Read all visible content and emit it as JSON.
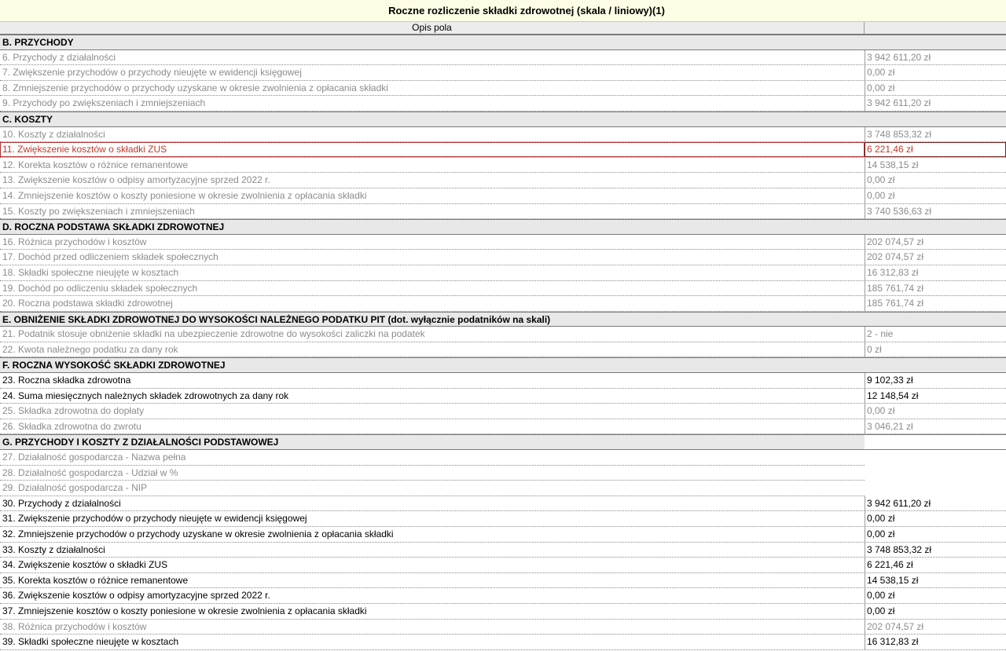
{
  "title": "Roczne rozliczenie składki zdrowotnej (skala / liniowy)(1)",
  "header": {
    "description_col": "Opis pola",
    "value_col": ""
  },
  "rows": [
    {
      "type": "section",
      "text": "B. PRZYCHODY",
      "full": true
    },
    {
      "type": "row",
      "text": "6. Przychody z działalności",
      "value": "3 942 611,20 zł",
      "gray": true
    },
    {
      "type": "row",
      "text": "7. Zwiększenie przychodów o przychody nieujęte w ewidencji księgowej",
      "value": "0,00 zł",
      "gray": true
    },
    {
      "type": "row",
      "text": "8. Zmniejszenie przychodów o przychody uzyskane w okresie zwolnienia z opłacania składki",
      "value": "0,00 zł",
      "gray": true
    },
    {
      "type": "row",
      "text": "9. Przychody po zwiększeniach i zmniejszeniach",
      "value": "3 942 611,20 zł",
      "gray": true
    },
    {
      "type": "section",
      "text": "C. KOSZTY",
      "full": true
    },
    {
      "type": "row",
      "text": "10. Koszty z działalności",
      "value": "3 748 853,32 zł",
      "gray": true
    },
    {
      "type": "row",
      "text": "11. Zwiększenie kosztów o składki ZUS",
      "value": "6 221,46 zł",
      "selected": true
    },
    {
      "type": "row",
      "text": "12. Korekta kosztów o różnice remanentowe",
      "value": "14 538,15 zł",
      "gray": true
    },
    {
      "type": "row",
      "text": "13. Zwiększenie kosztów o odpisy amortyzacyjne sprzed 2022 r.",
      "value": "0,00 zł",
      "gray": true
    },
    {
      "type": "row",
      "text": "14. Zmniejszenie kosztów o koszty poniesione w okresie zwolnienia z opłacania składki",
      "value": "0,00 zł",
      "gray": true
    },
    {
      "type": "row",
      "text": "15. Koszty po zwiększeniach i zmniejszeniach",
      "value": "3 740 536,63 zł",
      "gray": true
    },
    {
      "type": "section",
      "text": "D. ROCZNA PODSTAWA SKŁADKI ZDROWOTNEJ",
      "full": true
    },
    {
      "type": "row",
      "text": "16. Różnica przychodów i kosztów",
      "value": "202 074,57 zł",
      "gray": true
    },
    {
      "type": "row",
      "text": "17. Dochód przed odliczeniem składek społecznych",
      "value": "202 074,57 zł",
      "gray": true
    },
    {
      "type": "row",
      "text": "18. Składki społeczne nieujęte w kosztach",
      "value": "16 312,83 zł",
      "gray": true
    },
    {
      "type": "row",
      "text": "19. Dochód po odliczeniu składek społecznych",
      "value": "185 761,74 zł",
      "gray": true
    },
    {
      "type": "row",
      "text": "20. Roczna podstawa składki zdrowotnej",
      "value": "185 761,74 zł",
      "gray": true
    },
    {
      "type": "section",
      "text": "E. OBNIŻENIE SKŁADKI ZDROWOTNEJ DO WYSOKOŚCI NALEŻNEGO PODATKU PIT (dot. wyłącznie podatników na skali)",
      "full": true
    },
    {
      "type": "row",
      "text": "21. Podatnik stosuje obniżenie składki na ubezpieczenie zdrowotne do wysokości zaliczki na podatek",
      "value": "2 - nie",
      "gray": true
    },
    {
      "type": "row",
      "text": "22. Kwota należnego podatku za dany rok",
      "value": "0 zł",
      "gray": true
    },
    {
      "type": "section",
      "text": "F. ROCZNA WYSOKOŚĆ SKŁADKI ZDROWOTNEJ",
      "full": true
    },
    {
      "type": "row",
      "text": "23. Roczna składka zdrowotna",
      "value": "9 102,33 zł"
    },
    {
      "type": "row",
      "text": "24. Suma miesięcznych należnych składek zdrowotnych za dany rok",
      "value": "12 148,54 zł"
    },
    {
      "type": "row",
      "text": "25. Składka zdrowotna do dopłaty",
      "value": "0,00 zł",
      "gray": true
    },
    {
      "type": "row",
      "text": "26. Składka zdrowotna do zwrotu",
      "value": "3 046,21 zł",
      "gray": true
    },
    {
      "type": "section",
      "text": "G. PRZYCHODY I KOSZTY Z DZIAŁALNOŚCI PODSTAWOWEJ",
      "full": false
    },
    {
      "type": "row",
      "text": "27. Działalność gospodarcza - Nazwa pełna",
      "value": "",
      "gray": true,
      "noval": true
    },
    {
      "type": "row",
      "text": "28. Działalność gospodarcza - Udział w %",
      "value": "",
      "gray": true,
      "noval": true
    },
    {
      "type": "row",
      "text": "29. Działalność gospodarcza - NIP",
      "value": "",
      "gray": true,
      "noval": true
    },
    {
      "type": "row",
      "text": "30. Przychody z działalności",
      "value": "3 942 611,20 zł"
    },
    {
      "type": "row",
      "text": "31. Zwiększenie przychodów o przychody nieujęte w ewidencji księgowej",
      "value": "0,00 zł"
    },
    {
      "type": "row",
      "text": "32. Zmniejszenie przychodów o przychody uzyskane w okresie zwolnienia z opłacania składki",
      "value": "0,00 zł"
    },
    {
      "type": "row",
      "text": "33. Koszty z działalności",
      "value": "3 748 853,32 zł"
    },
    {
      "type": "row",
      "text": "34. Zwiększenie kosztów o składki ZUS",
      "value": "6 221,46 zł"
    },
    {
      "type": "row",
      "text": "35. Korekta kosztów o różnice remanentowe",
      "value": "14 538,15 zł"
    },
    {
      "type": "row",
      "text": "36. Zwiększenie kosztów o odpisy amortyzacyjne sprzed 2022 r.",
      "value": "0,00 zł"
    },
    {
      "type": "row",
      "text": "37. Zmniejszenie kosztów o koszty poniesione w okresie zwolnienia z opłacania składki",
      "value": "0,00 zł"
    },
    {
      "type": "row",
      "text": "38. Różnica przychodów i kosztów",
      "value": "202 074,57 zł",
      "gray": true
    },
    {
      "type": "row",
      "text": "39. Składki społeczne nieujęte w kosztach",
      "value": "16 312,83 zł"
    }
  ]
}
